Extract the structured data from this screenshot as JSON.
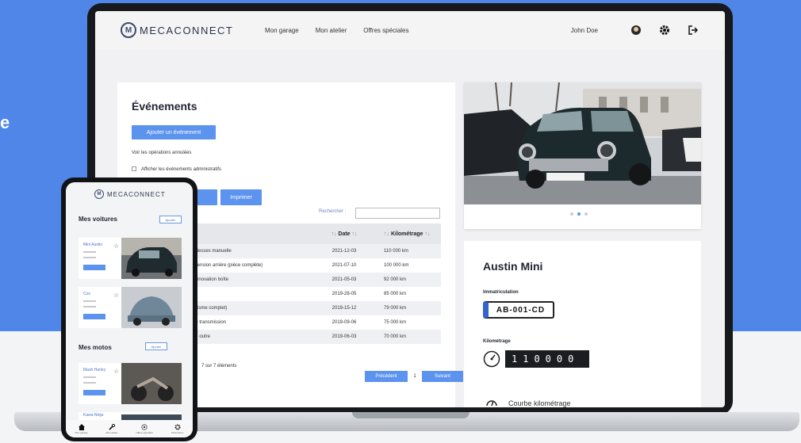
{
  "side_glyph": "e",
  "app": {
    "logo_mark": "M",
    "logo_text": "MECACONNECT",
    "nav": [
      "Mon garage",
      "Mon atelier",
      "Offres spéciales"
    ],
    "user_name": "John Doe",
    "icons": [
      "profile-icon",
      "gear-icon",
      "logout-icon"
    ]
  },
  "events": {
    "title": "Événements",
    "add_button": "Ajouter un événement",
    "cancelled_ops": "Voir les opérations annulées",
    "admin_events": "Afficher les événements administratifs",
    "print_button": "Imprimer",
    "search_label": "Rechercher :",
    "search_value": "",
    "columns": {
      "date": "Date",
      "km": "Kilométrage"
    },
    "rows": [
      {
        "desc": "ite vitesses manuelle",
        "date": "2021-12-03",
        "km": "110 000 km"
      },
      {
        "desc": "suspension arrière (pièce complète)",
        "date": "2021-07-10",
        "km": "100 000 km"
      },
      {
        "desc": "t / Rénovation boîte",
        "date": "2021-05-03",
        "km": "92 000 km"
      },
      {
        "desc": "",
        "date": "2019-28-05",
        "km": "85 000 km"
      },
      {
        "desc": "écanisme complet)",
        "date": "2019-15-12",
        "km": "79 000 km"
      },
      {
        "desc": "re de transmission",
        "date": "2019-09-06",
        "km": "75 000 km"
      },
      {
        "desc": "age - outre",
        "date": "2019-06-03",
        "km": "70 000 km"
      }
    ],
    "pager_info": "7 sur 7 éléments",
    "prev": "Précédent",
    "page": "1",
    "next": "Suivant"
  },
  "car": {
    "name": "Austin Mini",
    "plate_label": "Immatriculation",
    "plate": "AB-001-CD",
    "km_label": "Kilométrage",
    "odometer": "110000",
    "curve_label": "Courbe kilométrage"
  },
  "phone": {
    "logo_text": "MECACONNECT",
    "cars_title": "Mes voitures",
    "cars_add": "Ajouter",
    "cars": [
      {
        "name": "Mini Austin"
      },
      {
        "name": "Cox"
      }
    ],
    "motos_title": "Mes motos",
    "motos_add": "Ajouter",
    "motos": [
      {
        "name": "Mash Harley"
      },
      {
        "name": "Kawa Ninja"
      }
    ],
    "tabs": [
      {
        "icon": "home-icon",
        "label": "Mon garage"
      },
      {
        "icon": "wrench-icon",
        "label": "Mon atelier"
      },
      {
        "icon": "offer-icon",
        "label": "Offres spéciales"
      },
      {
        "icon": "gear-icon",
        "label": "Paramètres"
      }
    ]
  },
  "colors": {
    "brand_blue": "#4f86e8",
    "button_blue": "#5b93ee",
    "plate_eu_band": "#3366cc"
  }
}
